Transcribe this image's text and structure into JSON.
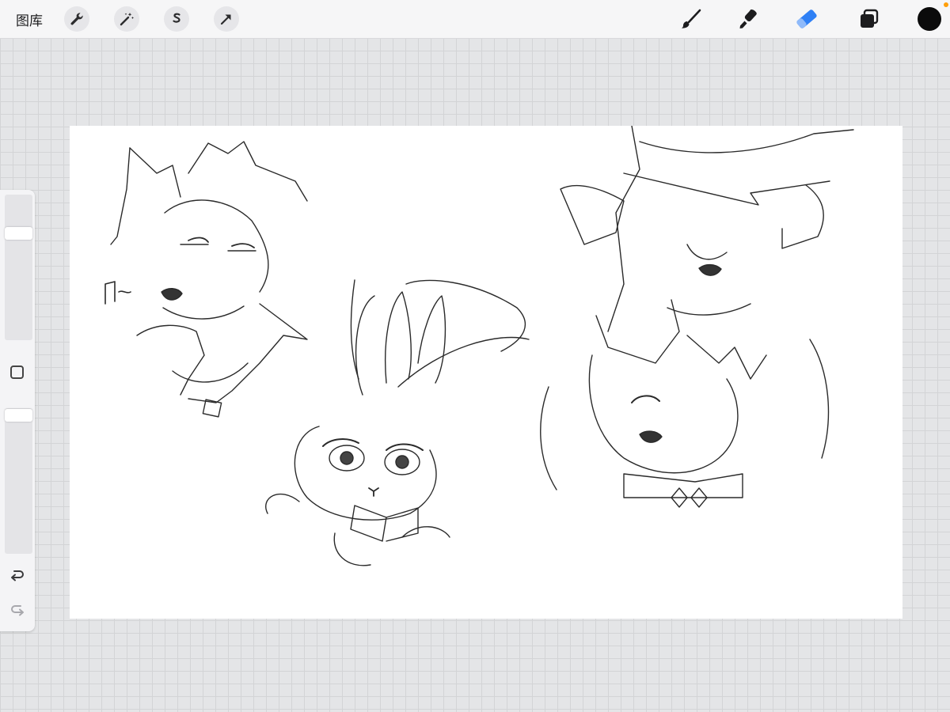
{
  "toolbar": {
    "gallery_label": "图库",
    "left_tools": [
      "wrench-icon",
      "magic-wand-icon",
      "selection-icon",
      "transform-arrow-icon"
    ],
    "right_tools": [
      "brush-icon",
      "smudge-icon",
      "eraser-icon",
      "layers-icon"
    ],
    "active_tool": "eraser",
    "accent_color": "#2f80f5",
    "current_color": "#0b0b0b",
    "notification_color": "#ff9f0a"
  },
  "sidebar": {
    "brush_size_level": 0.12,
    "opacity_level": 0.03,
    "icons": [
      "modify-square-icon",
      "undo-icon",
      "redo-icon"
    ]
  },
  "canvas": {
    "background": "#ffffff",
    "content": "sketch-drawing"
  }
}
